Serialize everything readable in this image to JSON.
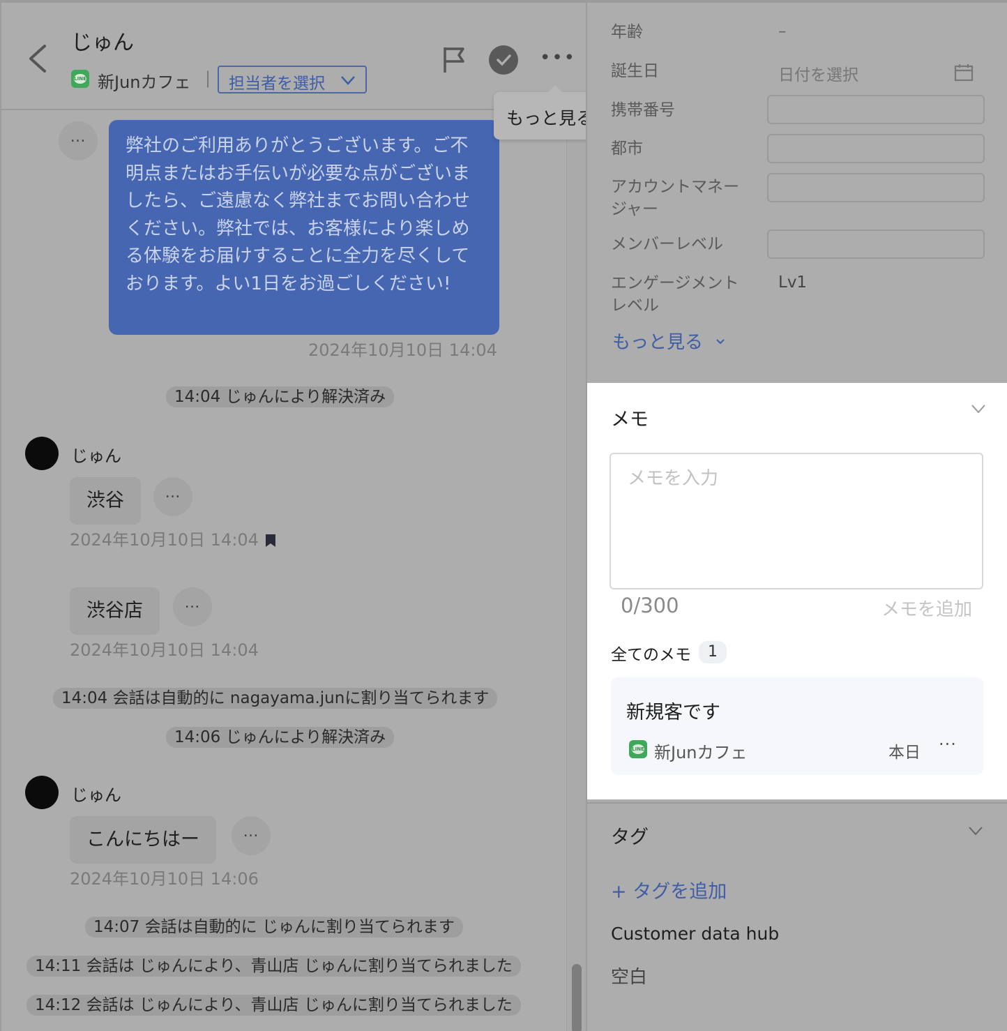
{
  "header": {
    "contact_name": "じゅん",
    "channel_name": "新Junカフェ",
    "separator": "|",
    "assignee_placeholder": "担当者を選択",
    "more_icon": "•••",
    "tooltip": "もっと見る"
  },
  "messages": {
    "outgoing_text": "弊社のご利用ありがとうございます。ご不明点またはお手伝いが必要な点がございましたら、ご遠慮なく弊社までお問い合わせください。弊社では、お客様により楽しめる体験をお届けすることに全力を尽くしております。よい1日をお過ごしください!",
    "outgoing_time": "2024年10月10日 14:04",
    "sys1": "14:04 じゅんにより解決済み",
    "sender1": "じゅん",
    "msg1_text": "渋谷",
    "msg1_time": "2024年10月10日 14:04",
    "msg2_text": "渋谷店",
    "msg2_time": "2024年10月10日 14:04",
    "sys2": "14:04 会話は自動的に  nagayama.junに割り当てられます",
    "sys3": "14:06 じゅんにより解決済み",
    "sender2": "じゅん",
    "msg3_text": "こんにちはー",
    "msg3_time": "2024年10月10日 14:06",
    "sys4": "14:07 会話は自動的に  じゅんに割り当てられます",
    "sys5": "14:11 会話は じゅんにより、青山店 じゅんに割り当てられました",
    "sys6": "14:12 会話は じゅんにより、青山店 じゅんに割り当てられました",
    "dots": "…"
  },
  "profile": {
    "age_label": "年齢",
    "age_value": "–",
    "birthday_label": "誕生日",
    "birthday_placeholder": "日付を選択",
    "phone_label": "携帯番号",
    "city_label": "都市",
    "account_manager_label": "アカウントマネージャー",
    "member_level_label": "メンバーレベル",
    "engagement_label": "エンゲージメントレベル",
    "engagement_value": "Lv1",
    "more_link": "もっと見る"
  },
  "memo": {
    "title": "メモ",
    "placeholder": "メモを入力",
    "count": "0/300",
    "add_button": "メモを追加",
    "all_label": "全てのメモ",
    "all_count": "1",
    "items": [
      {
        "text": "新規客です",
        "channel": "新Junカフェ",
        "date": "本日",
        "more": "···"
      }
    ]
  },
  "tags": {
    "title": "タグ",
    "add": "+ タグを追加",
    "group": "Customer data hub",
    "empty": "空白"
  },
  "colors": {
    "accent": "#3f5da6",
    "outgoing_bubble": "#4666b2",
    "line_green": "#3fa85a"
  }
}
